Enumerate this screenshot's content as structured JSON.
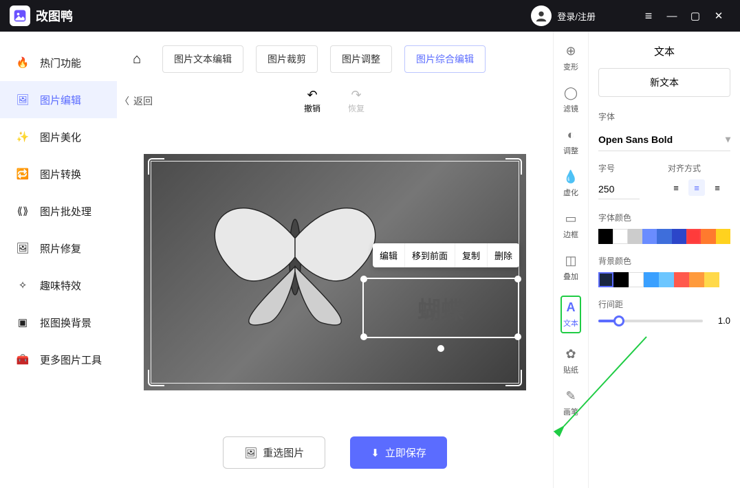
{
  "titlebar": {
    "app_name": "改图鸭",
    "login": "登录/注册"
  },
  "sidebar": {
    "items": [
      {
        "label": "热门功能"
      },
      {
        "label": "图片编辑"
      },
      {
        "label": "图片美化"
      },
      {
        "label": "图片转换"
      },
      {
        "label": "图片批处理"
      },
      {
        "label": "照片修复"
      },
      {
        "label": "趣味特效"
      },
      {
        "label": "抠图换背景"
      },
      {
        "label": "更多图片工具"
      }
    ]
  },
  "tabs": {
    "items": [
      {
        "label": "图片文本编辑"
      },
      {
        "label": "图片裁剪"
      },
      {
        "label": "图片调整"
      },
      {
        "label": "图片综合编辑"
      }
    ]
  },
  "back_label": "返回",
  "undo": {
    "label": "撤销"
  },
  "redo": {
    "label": "恢复"
  },
  "context_menu": {
    "edit": "编辑",
    "front": "移到前面",
    "copy": "复制",
    "delete": "删除"
  },
  "canvas_text": "蝴蝶",
  "bottom": {
    "reselect": "重选图片",
    "save": "立即保存"
  },
  "toolcol": {
    "transform": "变形",
    "filter": "滤镜",
    "adjust": "调整",
    "blur": "虚化",
    "border": "边框",
    "overlay": "叠加",
    "text": "文本",
    "sticker": "贴纸",
    "brush": "画笔"
  },
  "rpanel": {
    "title": "文本",
    "new_text": "新文本",
    "font_label": "字体",
    "font_value": "Open Sans Bold",
    "size_label": "字号",
    "size_value": "250",
    "align_label": "对齐方式",
    "font_color_label": "字体颜色",
    "bg_color_label": "背景颜色",
    "line_spacing_label": "行间距",
    "line_spacing_value": "1.0",
    "font_colors": [
      "#000000",
      "#ffffff",
      "#cccccc",
      "#6a8cff",
      "#3e6edb",
      "#2c46c9",
      "#ff3b3b",
      "#ff7a2e",
      "#ffd21f"
    ],
    "bg_colors": [
      "#1a2740",
      "#000000",
      "#ffffff",
      "#3aa0ff",
      "#6cc6ff",
      "#ff5a4d",
      "#ff9a3c",
      "#ffd94a"
    ]
  }
}
